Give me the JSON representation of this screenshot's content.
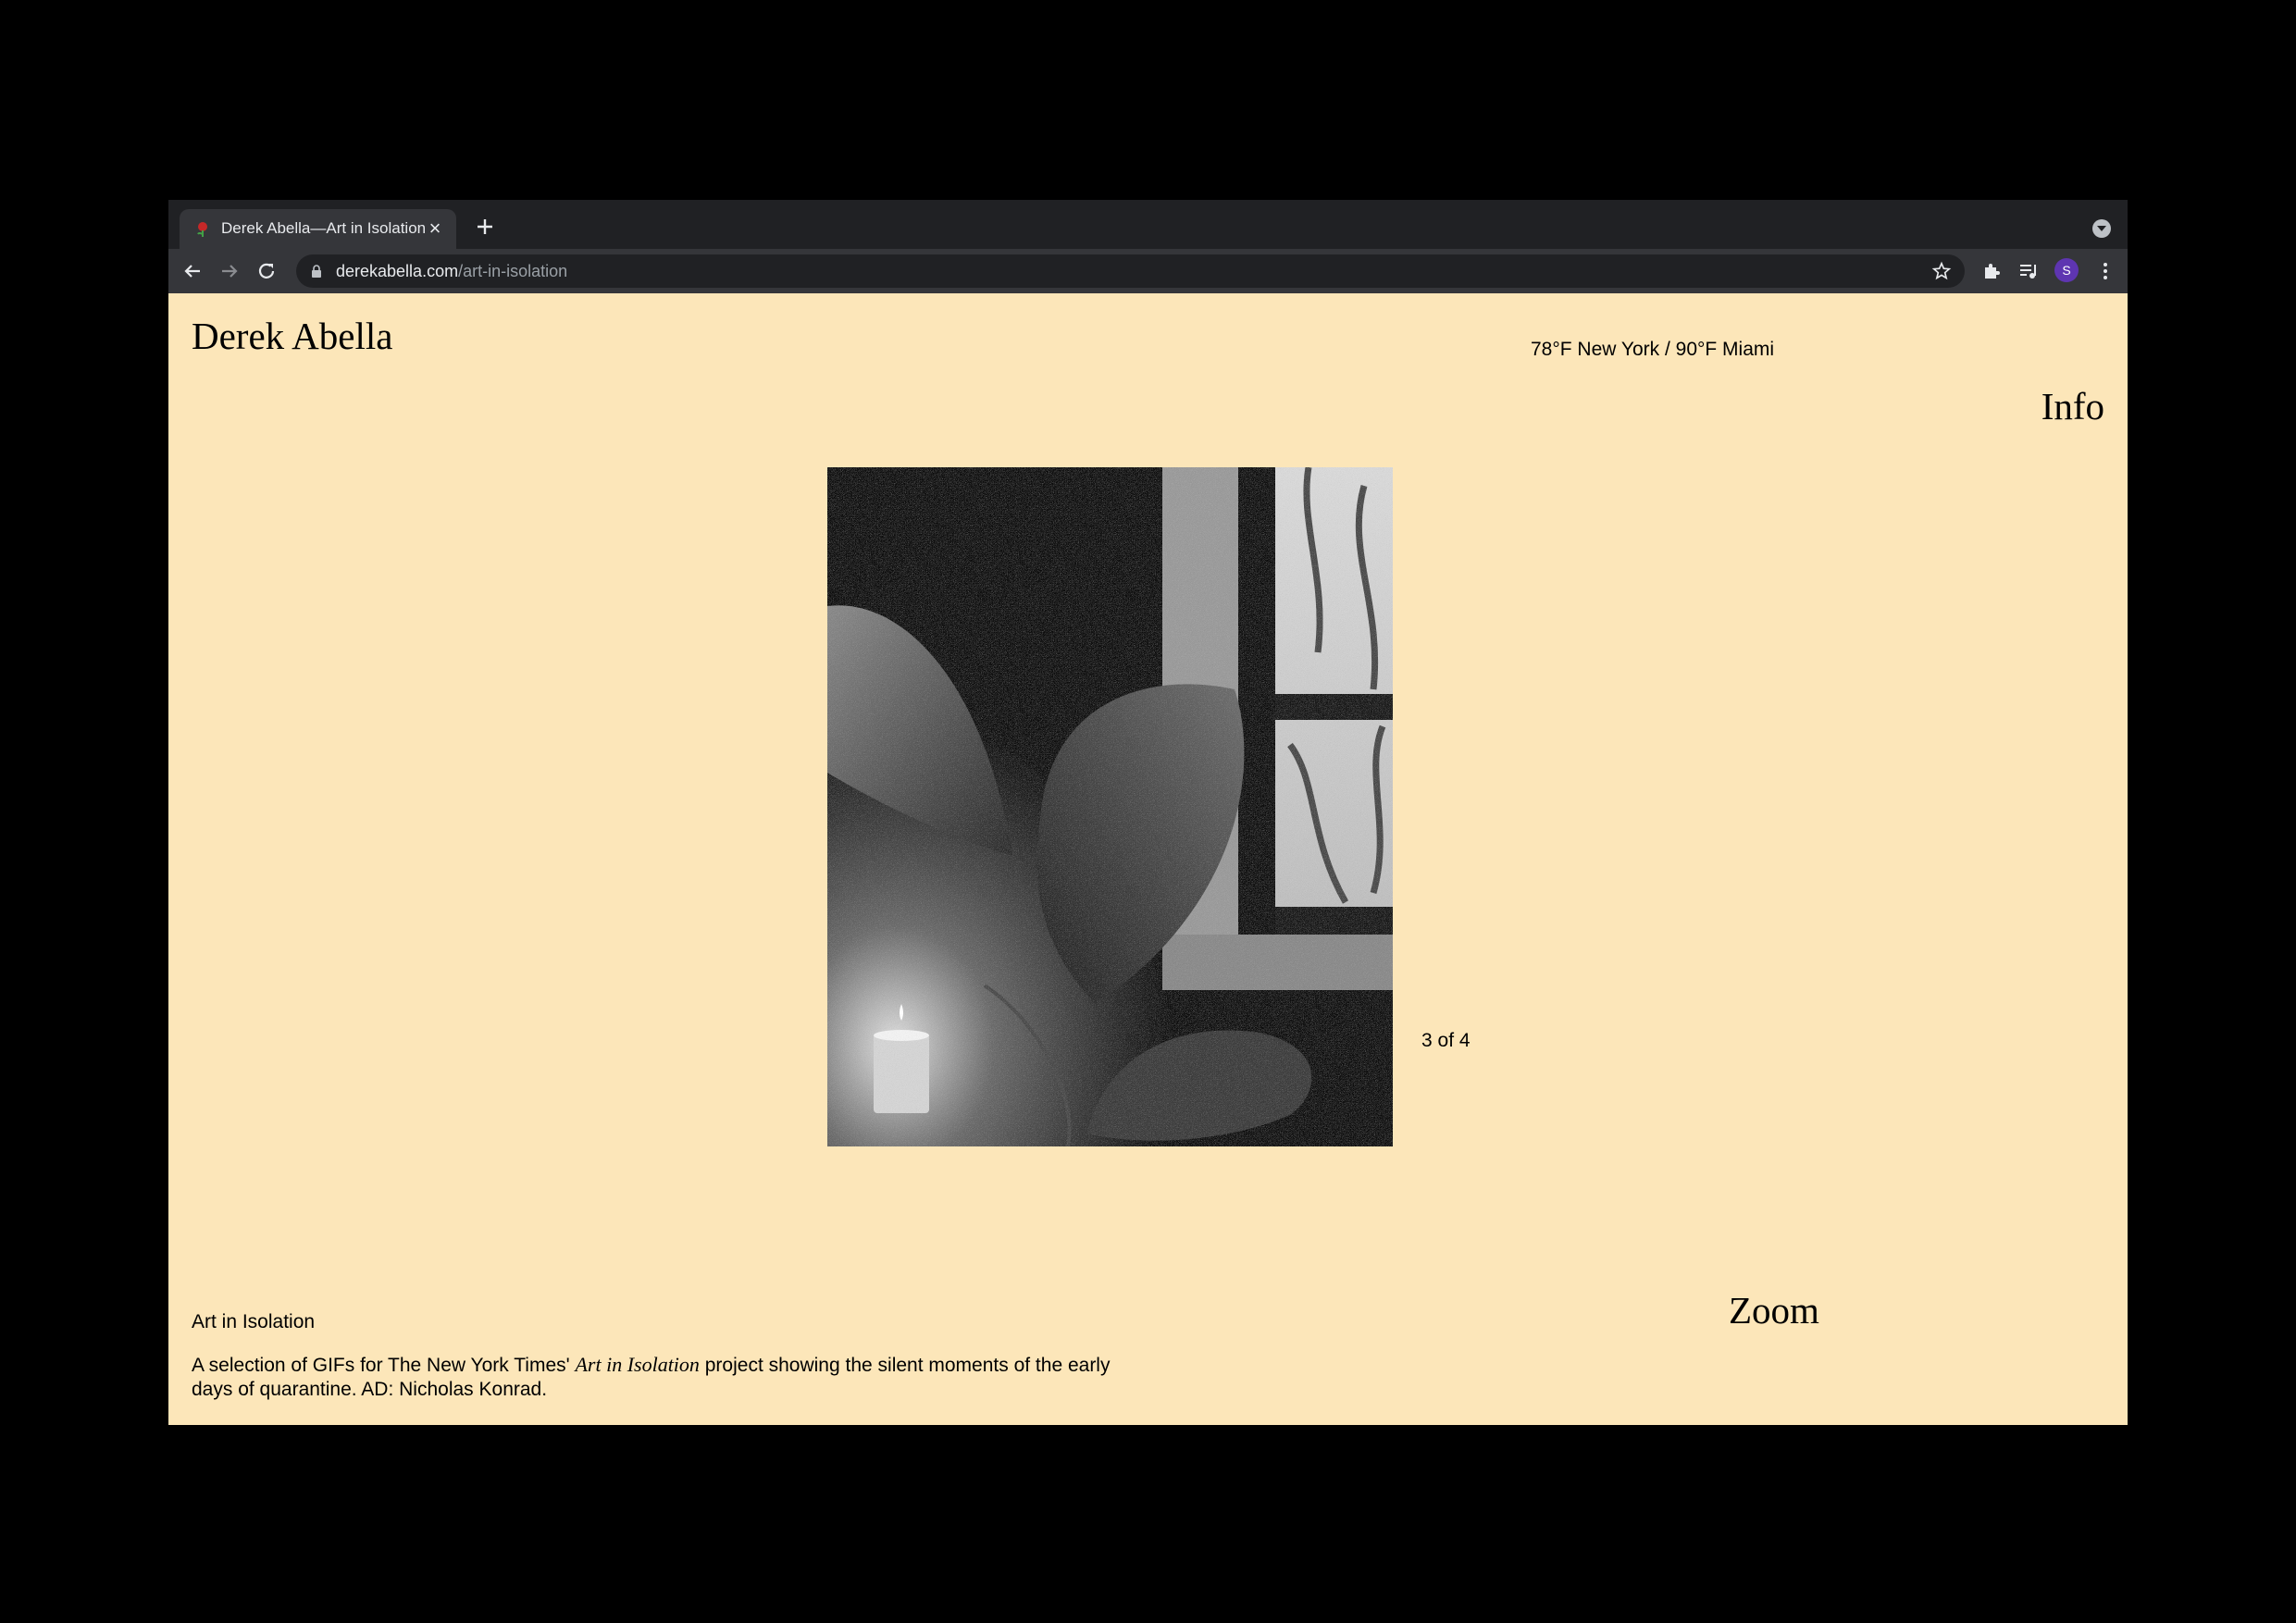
{
  "browser": {
    "tab": {
      "title": "Derek Abella—Art in Isolation",
      "close": "×"
    },
    "address": {
      "domain": "derekabella.com",
      "path": "/art-in-isolation"
    },
    "profile_initial": "S",
    "profile_color": "#5e35b1"
  },
  "page": {
    "site_name": "Derek Abella",
    "weather": "78°F New York / 90°F Miami",
    "info_label": "Info",
    "counter": "3 of 4",
    "project_title": "Art in Isolation",
    "desc_before": "A selection of GIFs for The New York Times' ",
    "desc_em": "Art in Isolation",
    "desc_after": " project showing the silent moments of the early days of quarantine. AD: Nicholas Konrad.",
    "zoom_label": "Zoom",
    "background_color": "#fce6b9"
  }
}
